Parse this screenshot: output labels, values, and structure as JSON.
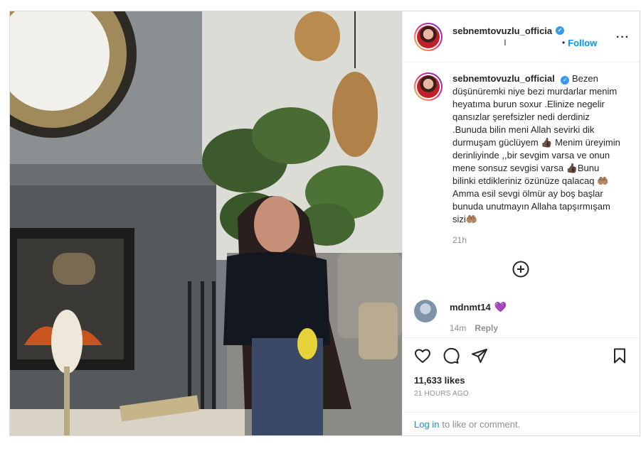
{
  "post": {
    "username": "sebnemtovuzlu_officia",
    "location": "l",
    "follow_label": "Follow",
    "dot": "•",
    "more_label": "···"
  },
  "caption": {
    "username": "sebnemtovuzlu_official",
    "text": "Bezen düşünüremki niye bezi murdarlar menim heyatıma burun soxur .Elinize negelir qansızlar şerefsizler nedi derdiniz .Bunuda bilin meni Allah sevirki dik durmuşam güclüyem 👍🏿 Menim üreyimin derinliyinde ,,bir sevgim varsa ve onun mene sonsuz sevgisi varsa 👍🏿Bunu bilinki etdikleriniz özünüze qalacaq 🤲🏽Amma esil sevgi ölmür ay boş başlar bunuda unutmayın Allaha tapşırmışam sizi🤲🏽",
    "time": "21h"
  },
  "comment": {
    "username": "mdnmt14",
    "emoji": "💜",
    "time": "14m",
    "reply_label": "Reply"
  },
  "actions": {
    "likes": "11,633 likes",
    "ago": "21 HOURS AGO"
  },
  "login": {
    "link": "Log in",
    "text": "to like or comment."
  },
  "colors": {
    "accent": "#0095f6",
    "verified": "#3897f0",
    "muted": "#8e8e8e",
    "border": "#dbdbdb"
  },
  "icons": [
    "heart-icon",
    "comment-icon",
    "share-icon",
    "bookmark-icon",
    "plus-circle-icon",
    "more-icon",
    "verified-icon"
  ]
}
